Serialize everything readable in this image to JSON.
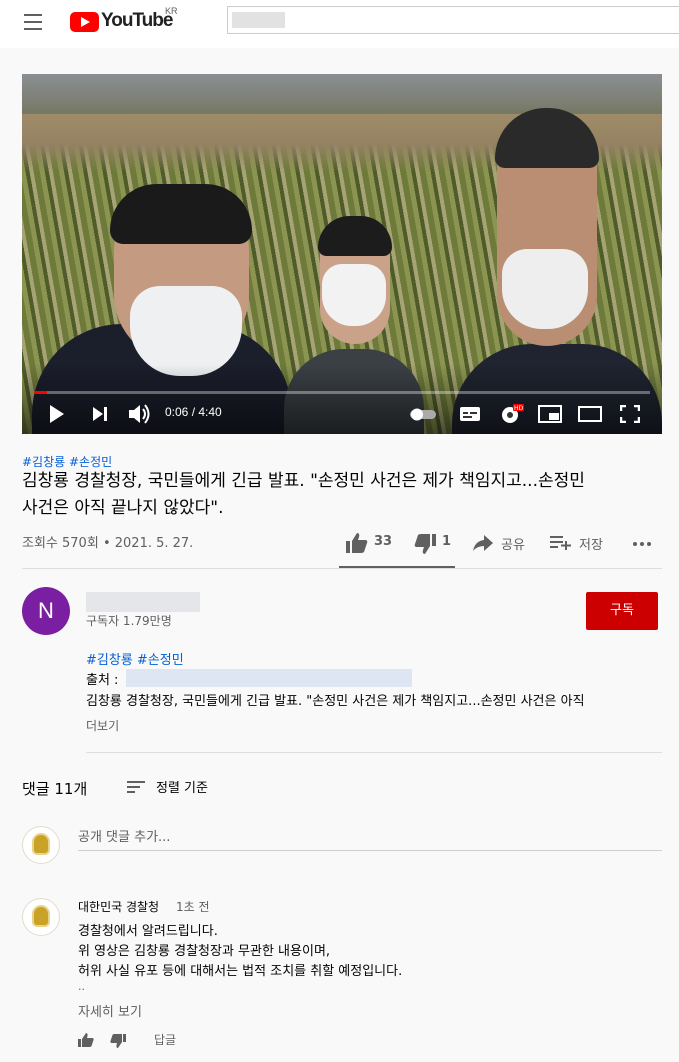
{
  "header": {
    "logo_text": "YouTube",
    "region": "KR"
  },
  "player": {
    "time_current": "0:06",
    "time_total": "4:40",
    "progress": 0.021
  },
  "video": {
    "tags_top": "#김창룡 #손정민",
    "title_line1": "김창룡 경찰청장, 국민들에게 긴급 발표. \"손정민 사건은 제가 책임지고...손정민",
    "title_line2": "사건은 아직 끝나지 않았다\".",
    "views": "조회수 570회",
    "date": "2021. 5. 27.",
    "meta_sep": "•"
  },
  "actions": {
    "likes": "33",
    "dislikes": "1",
    "share": "공유",
    "save": "저장"
  },
  "channel": {
    "avatar_letter": "N",
    "subscribers": "구독자 1.79만명",
    "subscribe_label": "구독",
    "colors": {
      "avatar": "#7b1fa2",
      "subscribe": "#cc0000"
    }
  },
  "description": {
    "tags": "#김창룡 #손정민",
    "source_label": "출처 :",
    "line": "김창룡 경찰청장, 국민들에게 긴급 발표. \"손정민 사건은 제가 책임지고...손정민 사건은 아직",
    "more": "더보기"
  },
  "comments": {
    "count": "댓글 11개",
    "sort": "정렬 기준",
    "add_placeholder": "공개 댓글 추가...",
    "items": [
      {
        "author": "대한민국 경찰청",
        "time": "1초 전",
        "lines": [
          "경찰청에서 알려드립니다.",
          "위 영상은 김창룡 경찰청장과 무관한 내용이며,",
          "허위 사실 유포 등에 대해서는 법적 조치를 취할 예정입니다."
        ],
        "ellipsis": "..",
        "read_more": "자세히 보기",
        "reply": "답글"
      }
    ]
  }
}
